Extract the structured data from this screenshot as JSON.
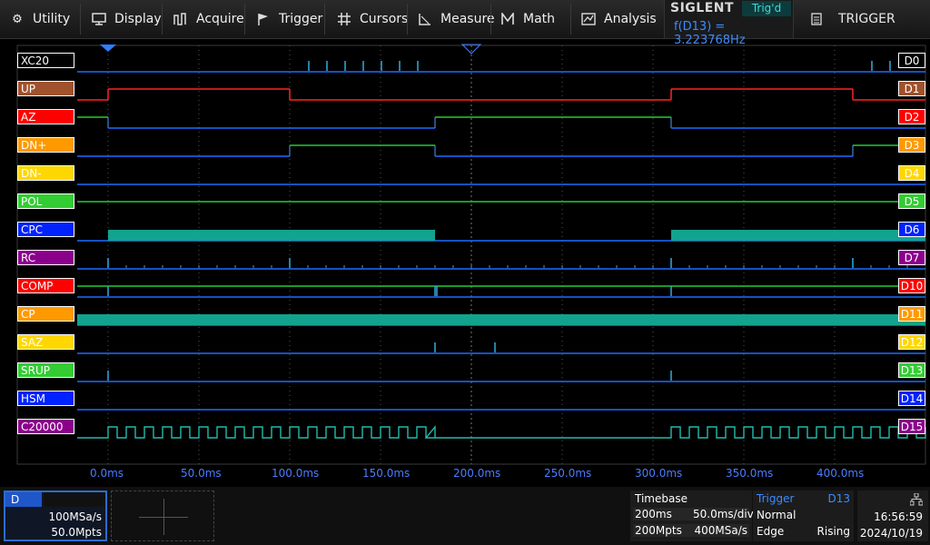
{
  "menu": {
    "items": [
      {
        "label": "Utility",
        "icon": "gear-icon"
      },
      {
        "label": "Display",
        "icon": "monitor-icon"
      },
      {
        "label": "Acquire",
        "icon": "acquire-icon"
      },
      {
        "label": "Trigger",
        "icon": "flag-icon"
      },
      {
        "label": "Cursors",
        "icon": "cursor-icon"
      },
      {
        "label": "Measure",
        "icon": "measure-icon"
      },
      {
        "label": "Math",
        "icon": "math-icon"
      },
      {
        "label": "Analysis",
        "icon": "analysis-icon"
      }
    ],
    "brand": "SIGLENT",
    "trig_state": "Trig'd",
    "frequency": "f(D13) = 3.223768Hz",
    "trigger_menu": "TRIGGER"
  },
  "channels": [
    {
      "name": "XC20",
      "id": "D0",
      "color": "#000000"
    },
    {
      "name": "UP",
      "id": "D1",
      "color": "#a0522d"
    },
    {
      "name": "AZ",
      "id": "D2",
      "color": "#ff0000"
    },
    {
      "name": "DN+",
      "id": "D3",
      "color": "#ff9900"
    },
    {
      "name": "DN-",
      "id": "D4",
      "color": "#ffd700"
    },
    {
      "name": "POL",
      "id": "D5",
      "color": "#33cc33"
    },
    {
      "name": "CPC",
      "id": "D6",
      "color": "#0022ff"
    },
    {
      "name": "RC",
      "id": "D7",
      "color": "#8b008b"
    },
    {
      "name": "COMP",
      "id": "D10",
      "color": "#ff0000"
    },
    {
      "name": "CP",
      "id": "D11",
      "color": "#ff9900"
    },
    {
      "name": "SAZ",
      "id": "D12",
      "color": "#ffd700"
    },
    {
      "name": "SRUP",
      "id": "D13",
      "color": "#33cc33"
    },
    {
      "name": "HSM",
      "id": "D14",
      "color": "#0022ff"
    },
    {
      "name": "C20000",
      "id": "D15",
      "color": "#8b008b"
    }
  ],
  "time_axis": [
    "0.0ms",
    "50.0ms",
    "100.0ms",
    "150.0ms",
    "200.0ms",
    "250.0ms",
    "300.0ms",
    "350.0ms",
    "400.0ms"
  ],
  "digital_panel": {
    "tag": "D",
    "sample_rate": "100MSa/s",
    "memory": "50.0Mpts"
  },
  "timebase": {
    "title": "Timebase",
    "delay": "200ms",
    "scale": "50.0ms/div",
    "memory": "200Mpts",
    "sample_rate": "400MSa/s"
  },
  "trigger": {
    "title": "Trigger",
    "source": "D13",
    "mode": "Normal",
    "type": "Edge",
    "slope": "Rising"
  },
  "clock": {
    "time": "16:56:59",
    "date": "2024/10/19"
  }
}
